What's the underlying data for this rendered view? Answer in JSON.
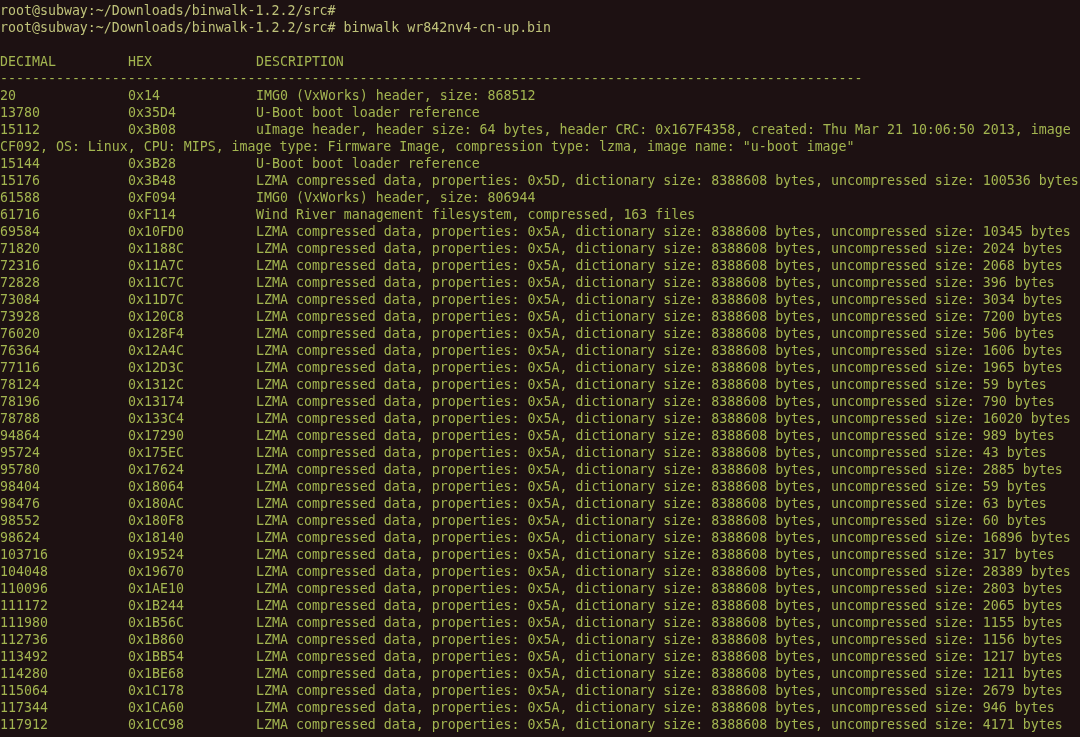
{
  "terminal": {
    "lines": [
      {
        "kind": "prompt",
        "text": "root@subway:~/Downloads/binwalk-1.2.2/src#"
      },
      {
        "kind": "prompt",
        "text": "root@subway:~/Downloads/binwalk-1.2.2/src# binwalk wr842nv4-cn-up.bin"
      },
      {
        "kind": "header",
        "columns": [
          "DECIMAL",
          "HEX",
          "DESCRIPTION"
        ]
      },
      {
        "kind": "rule",
        "text": "------------------------------------------------------------------------------------------------------------"
      },
      {
        "kind": "row",
        "decimal": "20",
        "hex": "0x14",
        "description": "IMG0 (VxWorks) header, size: 868512"
      },
      {
        "kind": "row",
        "decimal": "13780",
        "hex": "0x35D4",
        "description": "U-Boot boot loader reference"
      },
      {
        "kind": "row",
        "decimal": "15112",
        "hex": "0x3B08",
        "description": "uImage header, header size: 64 bytes, header CRC: 0x167F4358, created: Thu Mar 21 10:06:50 2013, image"
      },
      {
        "kind": "wrap",
        "text": "CF092, OS: Linux, CPU: MIPS, image type: Firmware Image, compression type: lzma, image name: \"u-boot image\""
      },
      {
        "kind": "row",
        "decimal": "15144",
        "hex": "0x3B28",
        "description": "U-Boot boot loader reference"
      },
      {
        "kind": "row",
        "decimal": "15176",
        "hex": "0x3B48",
        "description": "LZMA compressed data, properties: 0x5D, dictionary size: 8388608 bytes, uncompressed size: 100536 bytes"
      },
      {
        "kind": "row",
        "decimal": "61588",
        "hex": "0xF094",
        "description": "IMG0 (VxWorks) header, size: 806944"
      },
      {
        "kind": "row",
        "decimal": "61716",
        "hex": "0xF114",
        "description": "Wind River management filesystem, compressed, 163 files"
      },
      {
        "kind": "row",
        "decimal": "69584",
        "hex": "0x10FD0",
        "description": "LZMA compressed data, properties: 0x5A, dictionary size: 8388608 bytes, uncompressed size: 10345 bytes"
      },
      {
        "kind": "row",
        "decimal": "71820",
        "hex": "0x1188C",
        "description": "LZMA compressed data, properties: 0x5A, dictionary size: 8388608 bytes, uncompressed size: 2024 bytes"
      },
      {
        "kind": "row",
        "decimal": "72316",
        "hex": "0x11A7C",
        "description": "LZMA compressed data, properties: 0x5A, dictionary size: 8388608 bytes, uncompressed size: 2068 bytes"
      },
      {
        "kind": "row",
        "decimal": "72828",
        "hex": "0x11C7C",
        "description": "LZMA compressed data, properties: 0x5A, dictionary size: 8388608 bytes, uncompressed size: 396 bytes"
      },
      {
        "kind": "row",
        "decimal": "73084",
        "hex": "0x11D7C",
        "description": "LZMA compressed data, properties: 0x5A, dictionary size: 8388608 bytes, uncompressed size: 3034 bytes"
      },
      {
        "kind": "row",
        "decimal": "73928",
        "hex": "0x120C8",
        "description": "LZMA compressed data, properties: 0x5A, dictionary size: 8388608 bytes, uncompressed size: 7200 bytes"
      },
      {
        "kind": "row",
        "decimal": "76020",
        "hex": "0x128F4",
        "description": "LZMA compressed data, properties: 0x5A, dictionary size: 8388608 bytes, uncompressed size: 506 bytes"
      },
      {
        "kind": "row",
        "decimal": "76364",
        "hex": "0x12A4C",
        "description": "LZMA compressed data, properties: 0x5A, dictionary size: 8388608 bytes, uncompressed size: 1606 bytes"
      },
      {
        "kind": "row",
        "decimal": "77116",
        "hex": "0x12D3C",
        "description": "LZMA compressed data, properties: 0x5A, dictionary size: 8388608 bytes, uncompressed size: 1965 bytes"
      },
      {
        "kind": "row",
        "decimal": "78124",
        "hex": "0x1312C",
        "description": "LZMA compressed data, properties: 0x5A, dictionary size: 8388608 bytes, uncompressed size: 59 bytes"
      },
      {
        "kind": "row",
        "decimal": "78196",
        "hex": "0x13174",
        "description": "LZMA compressed data, properties: 0x5A, dictionary size: 8388608 bytes, uncompressed size: 790 bytes"
      },
      {
        "kind": "row",
        "decimal": "78788",
        "hex": "0x133C4",
        "description": "LZMA compressed data, properties: 0x5A, dictionary size: 8388608 bytes, uncompressed size: 16020 bytes"
      },
      {
        "kind": "row",
        "decimal": "94864",
        "hex": "0x17290",
        "description": "LZMA compressed data, properties: 0x5A, dictionary size: 8388608 bytes, uncompressed size: 989 bytes"
      },
      {
        "kind": "row",
        "decimal": "95724",
        "hex": "0x175EC",
        "description": "LZMA compressed data, properties: 0x5A, dictionary size: 8388608 bytes, uncompressed size: 43 bytes"
      },
      {
        "kind": "row",
        "decimal": "95780",
        "hex": "0x17624",
        "description": "LZMA compressed data, properties: 0x5A, dictionary size: 8388608 bytes, uncompressed size: 2885 bytes"
      },
      {
        "kind": "row",
        "decimal": "98404",
        "hex": "0x18064",
        "description": "LZMA compressed data, properties: 0x5A, dictionary size: 8388608 bytes, uncompressed size: 59 bytes"
      },
      {
        "kind": "row",
        "decimal": "98476",
        "hex": "0x180AC",
        "description": "LZMA compressed data, properties: 0x5A, dictionary size: 8388608 bytes, uncompressed size: 63 bytes"
      },
      {
        "kind": "row",
        "decimal": "98552",
        "hex": "0x180F8",
        "description": "LZMA compressed data, properties: 0x5A, dictionary size: 8388608 bytes, uncompressed size: 60 bytes"
      },
      {
        "kind": "row",
        "decimal": "98624",
        "hex": "0x18140",
        "description": "LZMA compressed data, properties: 0x5A, dictionary size: 8388608 bytes, uncompressed size: 16896 bytes"
      },
      {
        "kind": "row",
        "decimal": "103716",
        "hex": "0x19524",
        "description": "LZMA compressed data, properties: 0x5A, dictionary size: 8388608 bytes, uncompressed size: 317 bytes"
      },
      {
        "kind": "row",
        "decimal": "104048",
        "hex": "0x19670",
        "description": "LZMA compressed data, properties: 0x5A, dictionary size: 8388608 bytes, uncompressed size: 28389 bytes"
      },
      {
        "kind": "row",
        "decimal": "110096",
        "hex": "0x1AE10",
        "description": "LZMA compressed data, properties: 0x5A, dictionary size: 8388608 bytes, uncompressed size: 2803 bytes"
      },
      {
        "kind": "row",
        "decimal": "111172",
        "hex": "0x1B244",
        "description": "LZMA compressed data, properties: 0x5A, dictionary size: 8388608 bytes, uncompressed size: 2065 bytes"
      },
      {
        "kind": "row",
        "decimal": "111980",
        "hex": "0x1B56C",
        "description": "LZMA compressed data, properties: 0x5A, dictionary size: 8388608 bytes, uncompressed size: 1155 bytes"
      },
      {
        "kind": "row",
        "decimal": "112736",
        "hex": "0x1B860",
        "description": "LZMA compressed data, properties: 0x5A, dictionary size: 8388608 bytes, uncompressed size: 1156 bytes"
      },
      {
        "kind": "row",
        "decimal": "113492",
        "hex": "0x1BB54",
        "description": "LZMA compressed data, properties: 0x5A, dictionary size: 8388608 bytes, uncompressed size: 1217 bytes"
      },
      {
        "kind": "row",
        "decimal": "114280",
        "hex": "0x1BE68",
        "description": "LZMA compressed data, properties: 0x5A, dictionary size: 8388608 bytes, uncompressed size: 1211 bytes"
      },
      {
        "kind": "row",
        "decimal": "115064",
        "hex": "0x1C178",
        "description": "LZMA compressed data, properties: 0x5A, dictionary size: 8388608 bytes, uncompressed size: 2679 bytes"
      },
      {
        "kind": "row",
        "decimal": "117344",
        "hex": "0x1CA60",
        "description": "LZMA compressed data, properties: 0x5A, dictionary size: 8388608 bytes, uncompressed size: 946 bytes"
      },
      {
        "kind": "row",
        "decimal": "117912",
        "hex": "0x1CC98",
        "description": "LZMA compressed data, properties: 0x5A, dictionary size: 8388608 bytes, uncompressed size: 4171 bytes"
      }
    ]
  }
}
